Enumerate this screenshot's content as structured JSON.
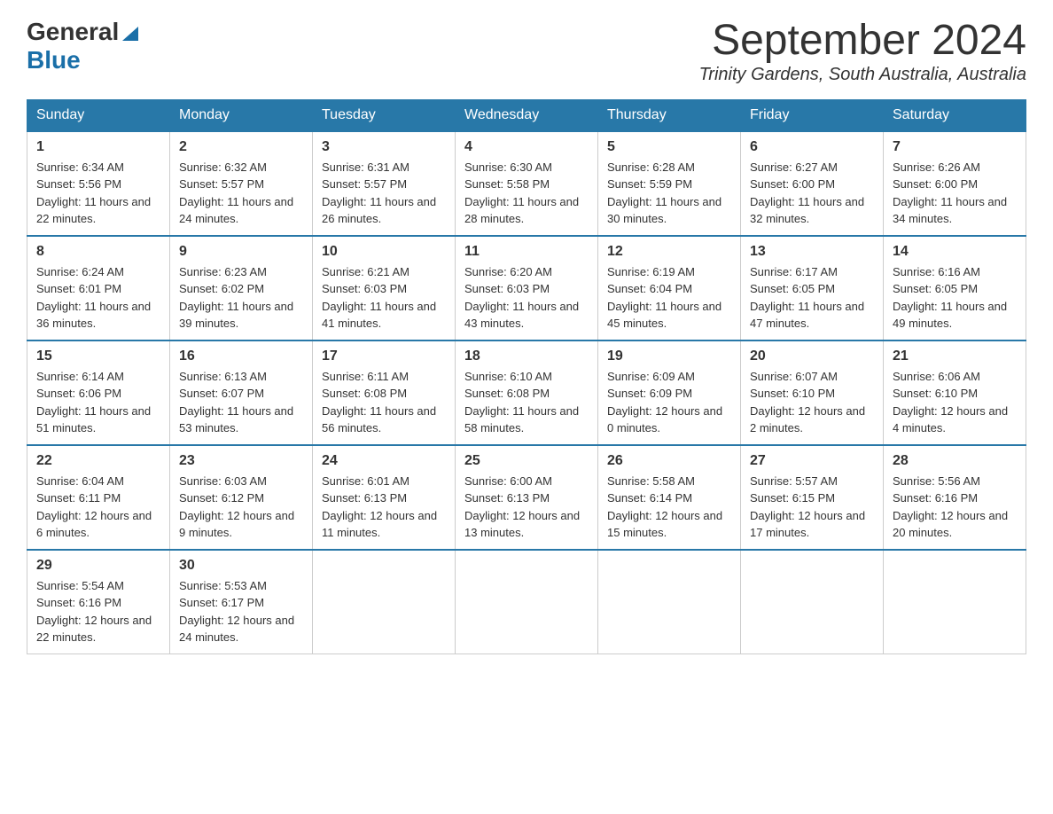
{
  "logo": {
    "general": "General",
    "blue": "Blue"
  },
  "title": {
    "month_year": "September 2024",
    "location": "Trinity Gardens, South Australia, Australia"
  },
  "weekdays": [
    "Sunday",
    "Monday",
    "Tuesday",
    "Wednesday",
    "Thursday",
    "Friday",
    "Saturday"
  ],
  "weeks": [
    [
      {
        "day": "1",
        "sunrise": "6:34 AM",
        "sunset": "5:56 PM",
        "daylight": "11 hours and 22 minutes."
      },
      {
        "day": "2",
        "sunrise": "6:32 AM",
        "sunset": "5:57 PM",
        "daylight": "11 hours and 24 minutes."
      },
      {
        "day": "3",
        "sunrise": "6:31 AM",
        "sunset": "5:57 PM",
        "daylight": "11 hours and 26 minutes."
      },
      {
        "day": "4",
        "sunrise": "6:30 AM",
        "sunset": "5:58 PM",
        "daylight": "11 hours and 28 minutes."
      },
      {
        "day": "5",
        "sunrise": "6:28 AM",
        "sunset": "5:59 PM",
        "daylight": "11 hours and 30 minutes."
      },
      {
        "day": "6",
        "sunrise": "6:27 AM",
        "sunset": "6:00 PM",
        "daylight": "11 hours and 32 minutes."
      },
      {
        "day": "7",
        "sunrise": "6:26 AM",
        "sunset": "6:00 PM",
        "daylight": "11 hours and 34 minutes."
      }
    ],
    [
      {
        "day": "8",
        "sunrise": "6:24 AM",
        "sunset": "6:01 PM",
        "daylight": "11 hours and 36 minutes."
      },
      {
        "day": "9",
        "sunrise": "6:23 AM",
        "sunset": "6:02 PM",
        "daylight": "11 hours and 39 minutes."
      },
      {
        "day": "10",
        "sunrise": "6:21 AM",
        "sunset": "6:03 PM",
        "daylight": "11 hours and 41 minutes."
      },
      {
        "day": "11",
        "sunrise": "6:20 AM",
        "sunset": "6:03 PM",
        "daylight": "11 hours and 43 minutes."
      },
      {
        "day": "12",
        "sunrise": "6:19 AM",
        "sunset": "6:04 PM",
        "daylight": "11 hours and 45 minutes."
      },
      {
        "day": "13",
        "sunrise": "6:17 AM",
        "sunset": "6:05 PM",
        "daylight": "11 hours and 47 minutes."
      },
      {
        "day": "14",
        "sunrise": "6:16 AM",
        "sunset": "6:05 PM",
        "daylight": "11 hours and 49 minutes."
      }
    ],
    [
      {
        "day": "15",
        "sunrise": "6:14 AM",
        "sunset": "6:06 PM",
        "daylight": "11 hours and 51 minutes."
      },
      {
        "day": "16",
        "sunrise": "6:13 AM",
        "sunset": "6:07 PM",
        "daylight": "11 hours and 53 minutes."
      },
      {
        "day": "17",
        "sunrise": "6:11 AM",
        "sunset": "6:08 PM",
        "daylight": "11 hours and 56 minutes."
      },
      {
        "day": "18",
        "sunrise": "6:10 AM",
        "sunset": "6:08 PM",
        "daylight": "11 hours and 58 minutes."
      },
      {
        "day": "19",
        "sunrise": "6:09 AM",
        "sunset": "6:09 PM",
        "daylight": "12 hours and 0 minutes."
      },
      {
        "day": "20",
        "sunrise": "6:07 AM",
        "sunset": "6:10 PM",
        "daylight": "12 hours and 2 minutes."
      },
      {
        "day": "21",
        "sunrise": "6:06 AM",
        "sunset": "6:10 PM",
        "daylight": "12 hours and 4 minutes."
      }
    ],
    [
      {
        "day": "22",
        "sunrise": "6:04 AM",
        "sunset": "6:11 PM",
        "daylight": "12 hours and 6 minutes."
      },
      {
        "day": "23",
        "sunrise": "6:03 AM",
        "sunset": "6:12 PM",
        "daylight": "12 hours and 9 minutes."
      },
      {
        "day": "24",
        "sunrise": "6:01 AM",
        "sunset": "6:13 PM",
        "daylight": "12 hours and 11 minutes."
      },
      {
        "day": "25",
        "sunrise": "6:00 AM",
        "sunset": "6:13 PM",
        "daylight": "12 hours and 13 minutes."
      },
      {
        "day": "26",
        "sunrise": "5:58 AM",
        "sunset": "6:14 PM",
        "daylight": "12 hours and 15 minutes."
      },
      {
        "day": "27",
        "sunrise": "5:57 AM",
        "sunset": "6:15 PM",
        "daylight": "12 hours and 17 minutes."
      },
      {
        "day": "28",
        "sunrise": "5:56 AM",
        "sunset": "6:16 PM",
        "daylight": "12 hours and 20 minutes."
      }
    ],
    [
      {
        "day": "29",
        "sunrise": "5:54 AM",
        "sunset": "6:16 PM",
        "daylight": "12 hours and 22 minutes."
      },
      {
        "day": "30",
        "sunrise": "5:53 AM",
        "sunset": "6:17 PM",
        "daylight": "12 hours and 24 minutes."
      },
      null,
      null,
      null,
      null,
      null
    ]
  ],
  "labels": {
    "sunrise": "Sunrise: ",
    "sunset": "Sunset: ",
    "daylight": "Daylight: "
  }
}
